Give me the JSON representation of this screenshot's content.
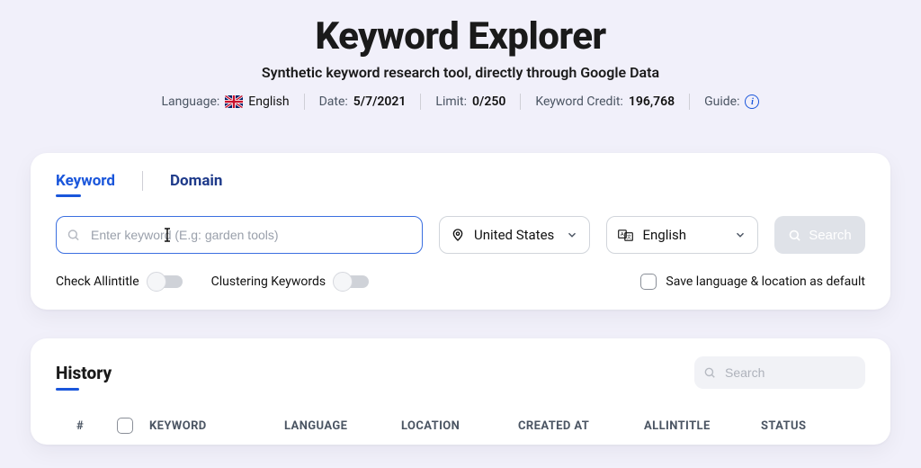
{
  "header": {
    "title": "Keyword Explorer",
    "subtitle": "Synthetic keyword research tool, directly through Google Data"
  },
  "meta": {
    "language_label": "Language:",
    "language_value": "English",
    "date_label": "Date:",
    "date_value": "5/7/2021",
    "limit_label": "Limit:",
    "limit_value": "0/250",
    "credit_label": "Keyword Credit:",
    "credit_value": "196,768",
    "guide_label": "Guide:"
  },
  "tabs": {
    "keyword": "Keyword",
    "domain": "Domain"
  },
  "search": {
    "keyword_placeholder": "Enter keyword (E.g: garden tools)",
    "country": "United States",
    "language": "English",
    "button": "Search"
  },
  "toggles": {
    "allintitle": "Check Allintitle",
    "clustering": "Clustering Keywords",
    "save_default": "Save language & location as default"
  },
  "history": {
    "title": "History",
    "search_placeholder": "Search",
    "columns": {
      "num": "#",
      "keyword": "KEYWORD",
      "language": "LANGUAGE",
      "location": "LOCATION",
      "created_at": "CREATED AT",
      "allintitle": "ALLINTITLE",
      "status": "STATUS"
    }
  }
}
